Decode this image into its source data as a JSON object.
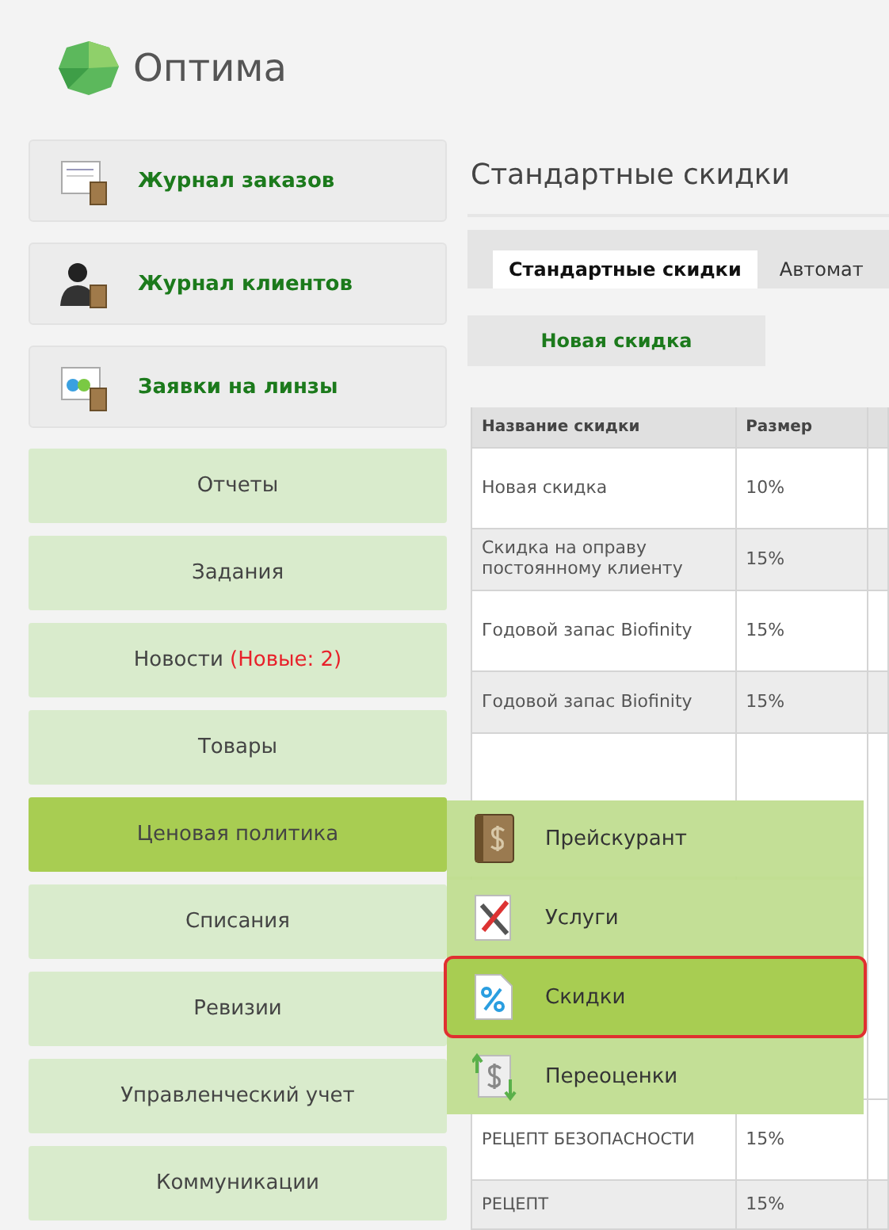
{
  "app": {
    "title": "Оптима"
  },
  "journals": [
    {
      "label": "Журнал заказов",
      "kind": "orders"
    },
    {
      "label": "Журнал клиентов",
      "kind": "clients"
    },
    {
      "label": "Заявки на линзы",
      "kind": "lenses"
    }
  ],
  "menu": [
    {
      "label": "Отчеты",
      "selected": false
    },
    {
      "label": "Задания",
      "selected": false
    },
    {
      "label": "Новости",
      "badge": "(Новые: 2)",
      "selected": false
    },
    {
      "label": "Товары",
      "selected": false
    },
    {
      "label": "Ценовая политика",
      "selected": true
    },
    {
      "label": "Списания",
      "selected": false
    },
    {
      "label": "Ревизии",
      "selected": false
    },
    {
      "label": "Управленческий учет",
      "selected": false
    },
    {
      "label": "Коммуникации",
      "selected": false
    }
  ],
  "submenu": [
    {
      "label": "Прейскурант",
      "kind": "pricebook",
      "selected": false
    },
    {
      "label": "Услуги",
      "kind": "services",
      "selected": false
    },
    {
      "label": "Скидки",
      "kind": "discounts",
      "selected": true
    },
    {
      "label": "Переоценки",
      "kind": "revaluation",
      "selected": false
    }
  ],
  "page": {
    "title": "Стандартные скидки",
    "tabs": [
      {
        "label": "Стандартные скидки",
        "selected": true
      },
      {
        "label": "Автомат",
        "selected": false
      }
    ],
    "new_button": "Новая скидка",
    "table": {
      "columns": [
        "Название скидки",
        "Размер"
      ],
      "rows": [
        {
          "name": "Новая скидка",
          "size": "10%"
        },
        {
          "name": "Скидка на оправу постоянному клиенту",
          "size": "15%"
        },
        {
          "name": "Годовой запас Biofinity",
          "size": "15%"
        },
        {
          "name": "Годовой запас Biofinity",
          "size": "15%"
        }
      ],
      "rows_below": [
        {
          "name": "РЕЦЕПТ БЕЗОПАСНОСТИ",
          "size": "15%"
        },
        {
          "name": "РЕЦЕПТ",
          "size": "15%"
        }
      ]
    }
  }
}
